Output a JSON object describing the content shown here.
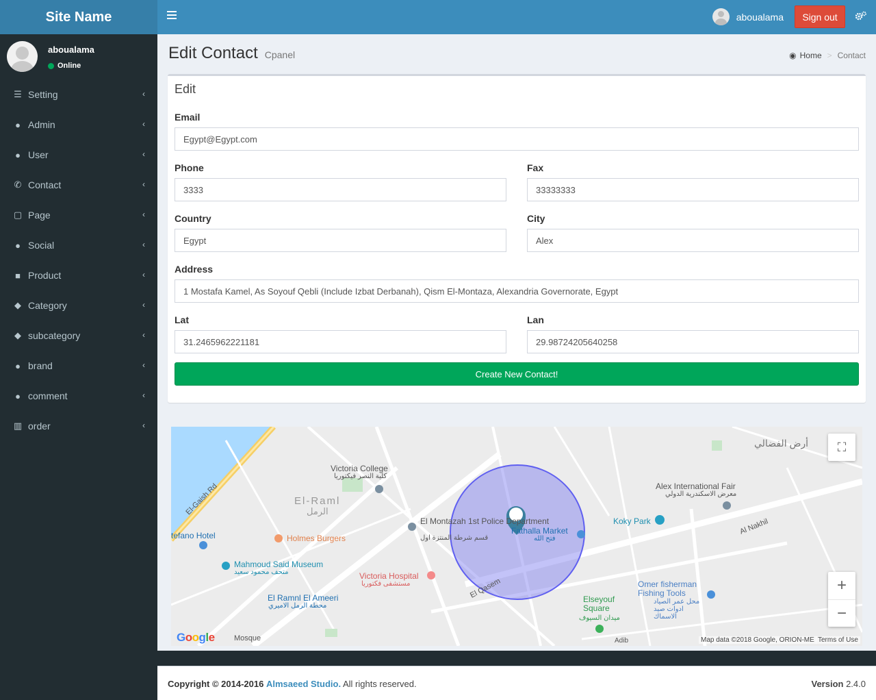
{
  "header": {
    "site_name": "Site Name",
    "username": "aboualama",
    "signout_label": "Sign out"
  },
  "sidebar": {
    "user_name": "aboualama",
    "user_status": "Online",
    "items": [
      {
        "label": "Setting",
        "icon": "list-icon"
      },
      {
        "label": "Admin",
        "icon": "user-icon"
      },
      {
        "label": "User",
        "icon": "user-icon"
      },
      {
        "label": "Contact",
        "icon": "phone-icon"
      },
      {
        "label": "Page",
        "icon": "edit-icon"
      },
      {
        "label": "Social",
        "icon": "users-icon"
      },
      {
        "label": "Product",
        "icon": "gift-icon"
      },
      {
        "label": "Category",
        "icon": "tag-icon"
      },
      {
        "label": "subcategory",
        "icon": "tags-icon"
      },
      {
        "label": "brand",
        "icon": "apple-icon"
      },
      {
        "label": "comment",
        "icon": "comments-icon"
      },
      {
        "label": "order",
        "icon": "barcode-icon"
      }
    ]
  },
  "page": {
    "title": "Edit Contact",
    "subtitle": "Cpanel",
    "breadcrumb_home": "Home",
    "breadcrumb_current": "Contact"
  },
  "form": {
    "box_title": "Edit",
    "email_label": "Email",
    "email_value": "Egypt@Egypt.com",
    "phone_label": "Phone",
    "phone_value": "3333",
    "fax_label": "Fax",
    "fax_value": "33333333",
    "country_label": "Country",
    "country_value": "Egypt",
    "city_label": "City",
    "city_value": "Alex",
    "address_label": "Address",
    "address_value": "1 Mostafa Kamel, As Soyouf Qebli (Include Izbat Derbanah), Qism El-Montaza, Alexandria Governorate, Egypt",
    "lat_label": "Lat",
    "lat_value": "31.2465962221181",
    "lan_label": "Lan",
    "lan_value": "29.98724205640258",
    "submit_label": "Create New Contact!"
  },
  "map": {
    "places": {
      "victoria_college": "Victoria College",
      "victoria_college_ar": "كلية النصر فيكتوريا",
      "el_raml": "El-Raml",
      "el_raml_ar": "الرمل",
      "holmes": "Holmes Burgers",
      "mahmoud_museum": "Mahmoud Said Museum",
      "mahmoud_museum_ar": "متحف محمود سعيد",
      "victoria_hospital": "Victoria Hospital",
      "victoria_hospital_ar": "مستشفى فكتوريا",
      "montazah_police": "El Montazah 1st Police Department",
      "montazah_police_ar": "قسم شرطة المنتزة اول",
      "fathalla": "Fathalla Market",
      "fathalla_ar": "فتح الله",
      "koky_park": "Koky Park",
      "alex_fair": "Alex International Fair",
      "alex_fair_ar": "معرض الاسكندرية الدولي",
      "omer_fisherman": "Omer fisherman Fishing Tools",
      "omer_fisherman_ar": "محل عمر الصياد ادوات صيد الاسماك",
      "elseyouf_square": "Elseyouf Square",
      "elseyouf_square_ar": "ميدان السيوف",
      "el_ramnl_ameeri": "El Ramnl El Ameeri",
      "el_ramnl_ameeri_ar": "محطة الرمل الاميري",
      "ard_el_fudali": "أرض الفضالي",
      "tefano_hotel": "tefano Hotel",
      "el_gaish_rd": "El-Gaish Rd",
      "el_qasem": "El Qasem",
      "al_nakhil": "Al Nakhil",
      "adib": "Adib",
      "mosque": "Mosque"
    },
    "attribution": "Map data ©2018 Google, ORION-ME",
    "terms": "Terms of Use",
    "google": "Google",
    "circle_color": "#7b7bf0"
  },
  "footer": {
    "copyright_prefix": "Copyright © 2014-2016",
    "company": "Almsaeed Studio.",
    "rights": "All rights reserved.",
    "version_label": "Version",
    "version_value": "2.4.0"
  }
}
